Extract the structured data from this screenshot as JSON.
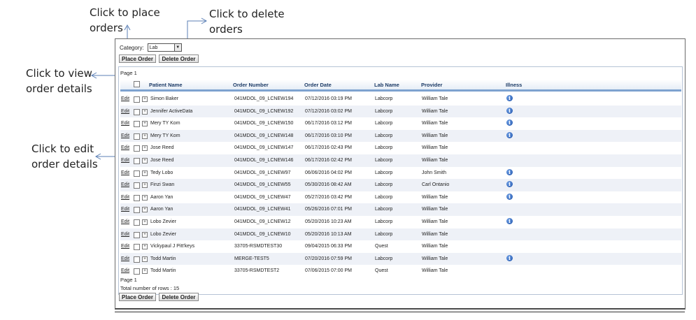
{
  "callouts": {
    "place": "Click to place\norders",
    "delete": "Click to delete\norders",
    "view": "Click to view\norder details",
    "edit": "Click to edit\norder details"
  },
  "toolbar": {
    "category_label": "Category:",
    "category_value": "Lab",
    "place_order": "Place Order",
    "delete_order": "Delete Order"
  },
  "grid": {
    "page_label_top": "Page 1",
    "page_label_bottom": "Page 1",
    "total_rows": "Total number of rows : 15",
    "columns": [
      "Patient Name",
      "Order Number",
      "Order Date",
      "Lab Name",
      "Provider",
      "Illness"
    ],
    "edit_label": "Edit",
    "info_glyph": "i",
    "rows": [
      {
        "patient": "Simon Baker",
        "order": "041MDOL_09_LCNEW194",
        "date": "07/12/2016 03:19 PM",
        "lab": "Labcorp",
        "provider": "William Tale",
        "illness": true
      },
      {
        "patient": "Jennifer ActiveData",
        "order": "041MDOL_09_LCNEW192",
        "date": "07/12/2016 03:02 PM",
        "lab": "Labcorp",
        "provider": "William Tale",
        "illness": true
      },
      {
        "patient": "Mery TY Kom",
        "order": "041MDOL_09_LCNEW150",
        "date": "06/17/2016 03:12 PM",
        "lab": "Labcorp",
        "provider": "William Tale",
        "illness": true
      },
      {
        "patient": "Mery TY Kom",
        "order": "041MDOL_09_LCNEW148",
        "date": "06/17/2016 03:10 PM",
        "lab": "Labcorp",
        "provider": "William Tale",
        "illness": true
      },
      {
        "patient": "Jose Reed",
        "order": "041MDOL_09_LCNEW147",
        "date": "06/17/2016 02:43 PM",
        "lab": "Labcorp",
        "provider": "William Tale",
        "illness": false
      },
      {
        "patient": "Jose Reed",
        "order": "041MDOL_09_LCNEW146",
        "date": "06/17/2016 02:42 PM",
        "lab": "Labcorp",
        "provider": "William Tale",
        "illness": false
      },
      {
        "patient": "Tedy Lobo",
        "order": "041MDOL_09_LCNEW97",
        "date": "06/06/2016 04:02 PM",
        "lab": "Labcorp",
        "provider": "John Smith",
        "illness": true
      },
      {
        "patient": "Finzi Swan",
        "order": "041MDOL_09_LCNEW55",
        "date": "05/30/2016 08:42 AM",
        "lab": "Labcorp",
        "provider": "Carl Ontanio",
        "illness": true
      },
      {
        "patient": "Aaron Yan",
        "order": "041MDOL_09_LCNEW47",
        "date": "05/27/2016 03:42 PM",
        "lab": "Labcorp",
        "provider": "William Tale",
        "illness": true
      },
      {
        "patient": "Aaron Yan",
        "order": "041MDOL_09_LCNEW41",
        "date": "05/26/2016 07:01 PM",
        "lab": "Labcorp",
        "provider": "William Tale",
        "illness": false
      },
      {
        "patient": "Lobo Zevier",
        "order": "041MDOL_09_LCNEW12",
        "date": "05/20/2016 10:23 AM",
        "lab": "Labcorp",
        "provider": "William Tale",
        "illness": true
      },
      {
        "patient": "Lobo Zevier",
        "order": "041MDOL_09_LCNEW10",
        "date": "05/20/2016 10:13 AM",
        "lab": "Labcorp",
        "provider": "William Tale",
        "illness": false
      },
      {
        "patient": "Vickypaul J Pitt'keys",
        "order": "33705-RSMDTEST30",
        "date": "09/04/2015 06:33 PM",
        "lab": "Quest",
        "provider": "William Tale",
        "illness": false
      },
      {
        "patient": "Todd Martin",
        "order": "MERGE-TEST5",
        "date": "07/20/2016 07:59 PM",
        "lab": "Labcorp",
        "provider": "William Tale",
        "illness": true
      },
      {
        "patient": "Todd Martin",
        "order": "33705-RSMDTEST2",
        "date": "07/06/2015 07:00 PM",
        "lab": "Quest",
        "provider": "William Tale",
        "illness": false
      }
    ]
  }
}
